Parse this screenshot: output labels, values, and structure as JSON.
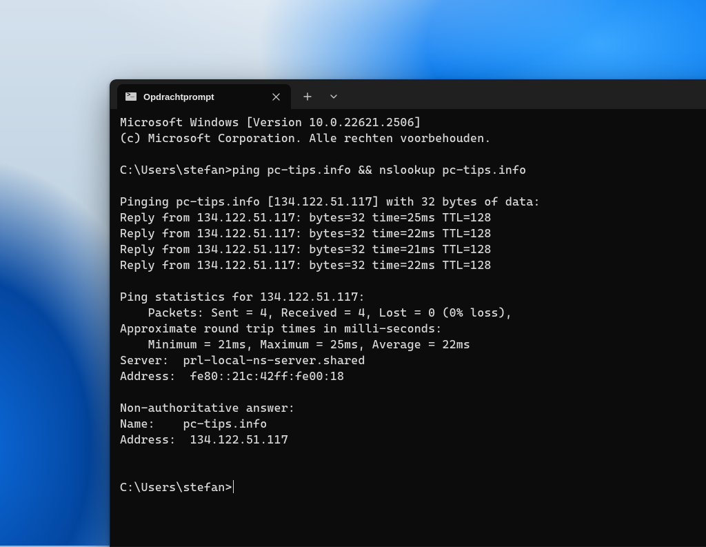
{
  "tab": {
    "title": "Opdrachtprompt"
  },
  "terminal": {
    "lines": [
      "Microsoft Windows [Version 10.0.22621.2506]",
      "(c) Microsoft Corporation. Alle rechten voorbehouden.",
      "",
      "C:\\Users\\stefan>ping pc-tips.info && nslookup pc-tips.info",
      "",
      "Pinging pc-tips.info [134.122.51.117] with 32 bytes of data:",
      "Reply from 134.122.51.117: bytes=32 time=25ms TTL=128",
      "Reply from 134.122.51.117: bytes=32 time=22ms TTL=128",
      "Reply from 134.122.51.117: bytes=32 time=21ms TTL=128",
      "Reply from 134.122.51.117: bytes=32 time=22ms TTL=128",
      "",
      "Ping statistics for 134.122.51.117:",
      "    Packets: Sent = 4, Received = 4, Lost = 0 (0% loss),",
      "Approximate round trip times in milli-seconds:",
      "    Minimum = 21ms, Maximum = 25ms, Average = 22ms",
      "Server:  prl-local-ns-server.shared",
      "Address:  fe80::21c:42ff:fe00:18",
      "",
      "Non-authoritative answer:",
      "Name:    pc-tips.info",
      "Address:  134.122.51.117",
      "",
      "",
      "C:\\Users\\stefan>"
    ]
  }
}
